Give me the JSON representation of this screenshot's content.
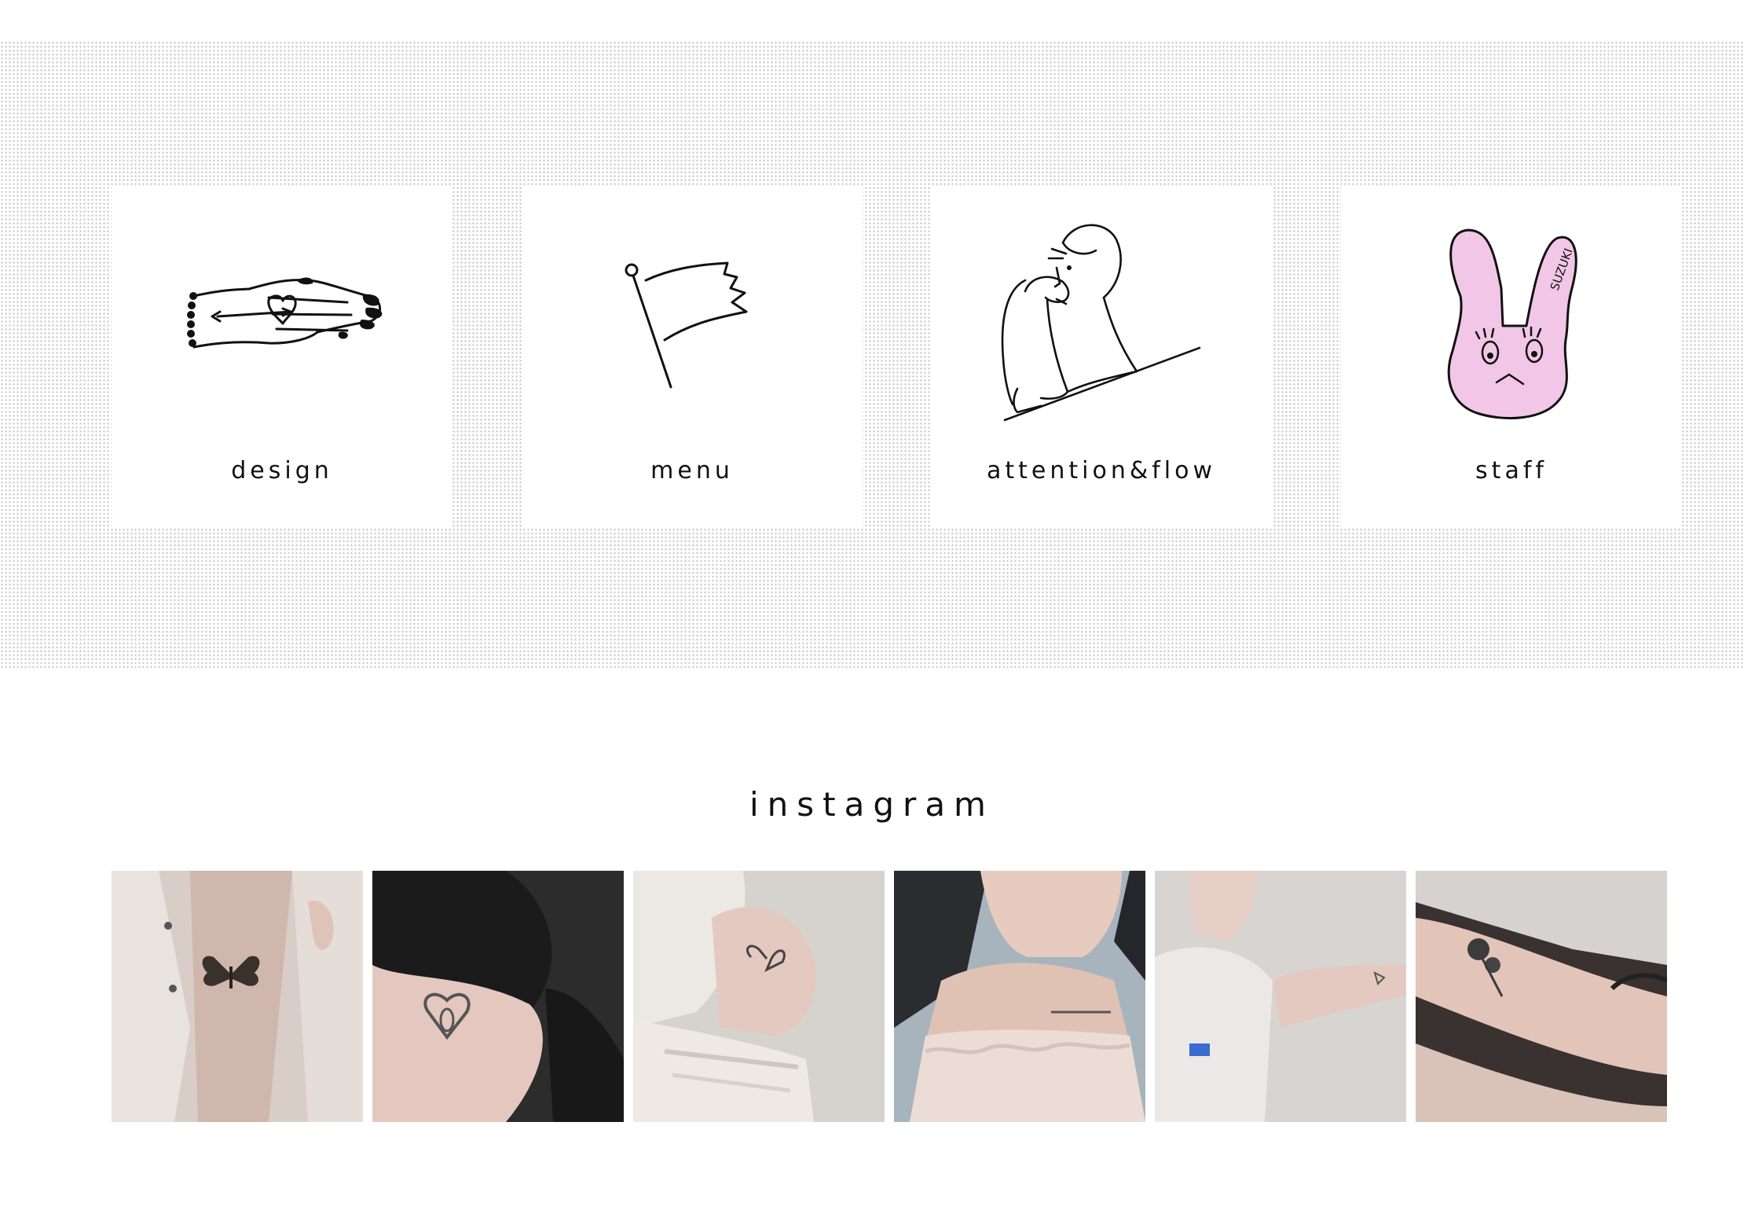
{
  "nav_cards": [
    {
      "label": "design",
      "icon": "tattooed-hand-icon"
    },
    {
      "label": "menu",
      "icon": "flag-icon"
    },
    {
      "label": "attention&flow",
      "icon": "thinking-person-icon"
    },
    {
      "label": "staff",
      "icon": "pink-bunny-icon"
    }
  ],
  "bunny_tag": "SUZUKI",
  "instagram": {
    "title": "instagram",
    "posts": [
      {
        "icon": "butterfly-chest-tattoo-photo"
      },
      {
        "icon": "heart-arm-tattoo-photo"
      },
      {
        "icon": "angel-wing-shoulder-tattoo-photo"
      },
      {
        "icon": "collarbone-script-tattoo-photo"
      },
      {
        "icon": "small-arm-tattoo-photo"
      },
      {
        "icon": "flower-forearm-tattoo-photo"
      }
    ]
  },
  "colors": {
    "bunny_pink": "#f2c6e6",
    "ink": "#111111",
    "dot": "#c4c4c4"
  }
}
